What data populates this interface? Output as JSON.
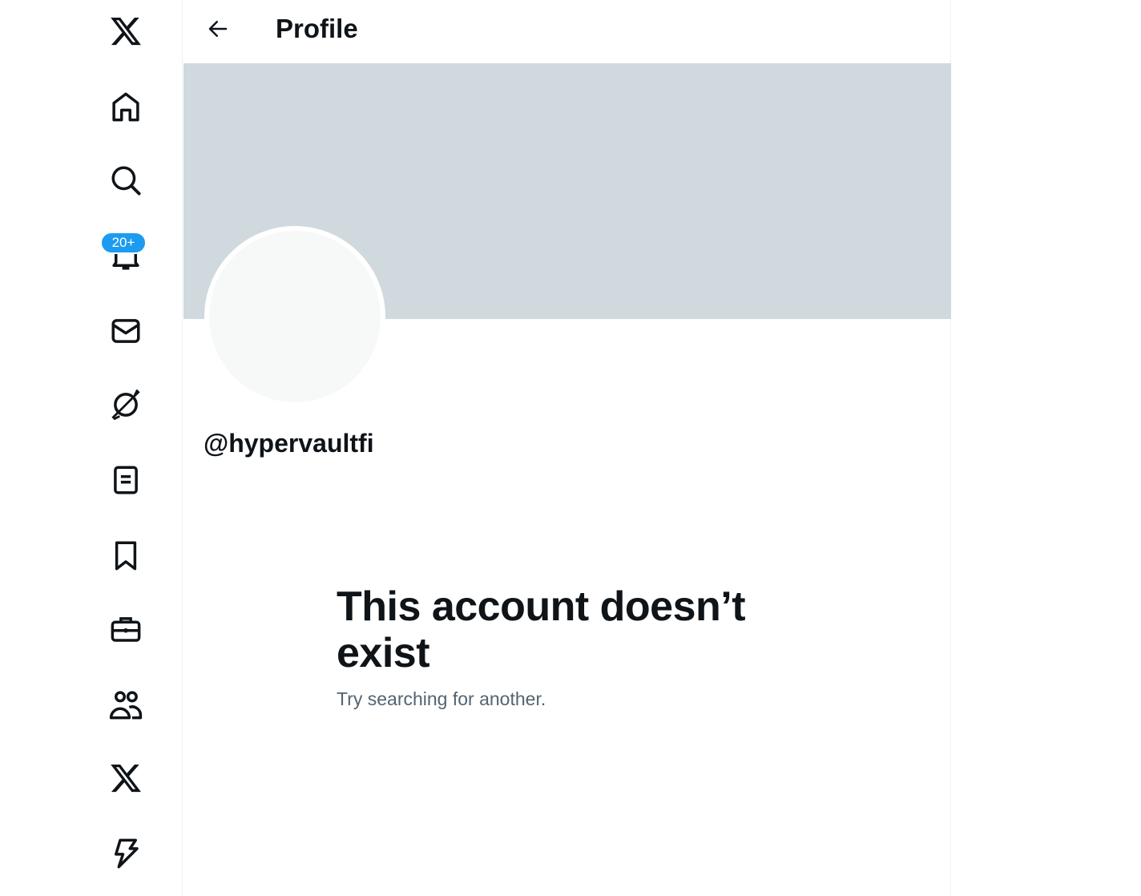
{
  "sidebar": {
    "items": [
      {
        "name": "logo",
        "icon": "x-logo-icon"
      },
      {
        "name": "home",
        "icon": "home-icon"
      },
      {
        "name": "explore",
        "icon": "search-icon"
      },
      {
        "name": "notifications",
        "icon": "bell-icon"
      },
      {
        "name": "messages",
        "icon": "mail-icon"
      },
      {
        "name": "grok",
        "icon": "grok-icon"
      },
      {
        "name": "lists",
        "icon": "list-icon"
      },
      {
        "name": "bookmarks",
        "icon": "bookmark-icon"
      },
      {
        "name": "jobs",
        "icon": "briefcase-icon"
      },
      {
        "name": "communities",
        "icon": "people-icon"
      },
      {
        "name": "premium",
        "icon": "x-logo-icon"
      },
      {
        "name": "verified-orgs",
        "icon": "lightning-icon"
      }
    ],
    "notification_badge": "20+"
  },
  "header": {
    "title": "Profile"
  },
  "profile": {
    "handle": "@hypervaultfi"
  },
  "empty_state": {
    "title": "This account doesn’t exist",
    "subtitle": "Try searching for another."
  },
  "colors": {
    "accent": "#1d9bf0",
    "banner": "#cfd9de",
    "avatar": "#f7f9f9",
    "text": "#0f1419",
    "secondary_text": "#536471"
  }
}
